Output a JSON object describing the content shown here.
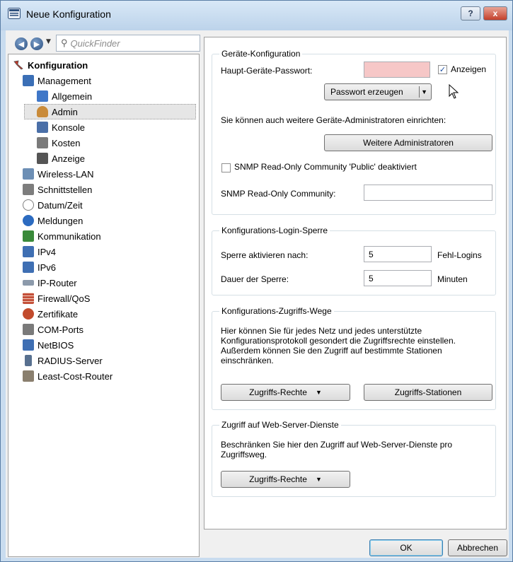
{
  "window": {
    "title": "Neue Konfiguration",
    "help_label": "?",
    "close_label": "x"
  },
  "nav": {
    "quickfinder_placeholder": "QuickFinder"
  },
  "tree": {
    "root": "Konfiguration",
    "items": [
      {
        "label": "Management",
        "icon": "management-icon",
        "color": "#3b6fb6"
      },
      {
        "label": "Allgemein",
        "icon": "general-icon",
        "color": "#3f77c8"
      },
      {
        "label": "Admin",
        "icon": "admin-user-icon",
        "color": "#c98b3a"
      },
      {
        "label": "Konsole",
        "icon": "console-icon",
        "color": "#4a6fa8"
      },
      {
        "label": "Kosten",
        "icon": "costs-icon",
        "color": "#7a7a7a"
      },
      {
        "label": "Anzeige",
        "icon": "display-icon",
        "color": "#555555"
      },
      {
        "label": "Wireless-LAN",
        "icon": "wireless-lan-icon",
        "color": "#6d8fb5"
      },
      {
        "label": "Schnittstellen",
        "icon": "interfaces-icon",
        "color": "#7d7d7d"
      },
      {
        "label": "Datum/Zeit",
        "icon": "clock-icon",
        "color": "#7f7f7f"
      },
      {
        "label": "Meldungen",
        "icon": "info-icon",
        "color": "#2c6bc0"
      },
      {
        "label": "Kommunikation",
        "icon": "communication-icon",
        "color": "#3a8a3a"
      },
      {
        "label": "IPv4",
        "icon": "network-icon",
        "color": "#3f6fb3"
      },
      {
        "label": "IPv6",
        "icon": "network-icon",
        "color": "#3f6fb3"
      },
      {
        "label": "IP-Router",
        "icon": "router-icon",
        "color": "#8c9aab"
      },
      {
        "label": "Firewall/QoS",
        "icon": "firewall-icon",
        "color": "#c4503a"
      },
      {
        "label": "Zertifikate",
        "icon": "certificate-icon",
        "color": "#c24b2c"
      },
      {
        "label": "COM-Ports",
        "icon": "com-port-icon",
        "color": "#7a7a7a"
      },
      {
        "label": "NetBIOS",
        "icon": "network-icon",
        "color": "#3f6fb3"
      },
      {
        "label": "RADIUS-Server",
        "icon": "server-icon",
        "color": "#58708f"
      },
      {
        "label": "Least-Cost-Router",
        "icon": "least-cost-router-icon",
        "color": "#8a7f6e"
      }
    ]
  },
  "geraete": {
    "legend": "Geräte-Konfiguration",
    "password_label": "Haupt-Geräte-Passwort:",
    "show_label": "Anzeigen",
    "generate_button": "Passwort erzeugen",
    "info_text": "Sie können auch weitere Geräte-Administratoren einrichten:",
    "more_admins_button": "Weitere Administratoren",
    "snmp_checkbox_label": "SNMP Read-Only Community 'Public' deaktiviert",
    "snmp_community_label": "SNMP Read-Only Community:",
    "snmp_community_value": ""
  },
  "login_sperre": {
    "legend": "Konfigurations-Login-Sperre",
    "activate_label": "Sperre aktivieren nach:",
    "activate_value": "5",
    "activate_unit": "Fehl-Logins",
    "duration_label": "Dauer der Sperre:",
    "duration_value": "5",
    "duration_unit": "Minuten"
  },
  "zugriffs_wege": {
    "legend": "Konfigurations-Zugriffs-Wege",
    "text_line1": "Hier können Sie für jedes Netz und jedes unterstützte",
    "text_line2": "Konfigurationsprotokoll gesondert die Zugriffsrechte einstellen.",
    "text_line3": "Außerdem können Sie den Zugriff auf bestimmte Stationen",
    "text_line4": "einschränken.",
    "rights_button": "Zugriffs-Rechte",
    "stations_button": "Zugriffs-Stationen"
  },
  "web_server": {
    "legend": "Zugriff auf Web-Server-Dienste",
    "text_line1": "Beschränken Sie hier den Zugriff auf Web-Server-Dienste pro",
    "text_line2": "Zugriffsweg.",
    "rights_button": "Zugriffs-Rechte"
  },
  "footer": {
    "ok_button": "OK",
    "cancel_button": "Abbrechen"
  },
  "colors": {
    "password_field_bg": "#f6c7c7",
    "title_bar": "#c9dcef"
  }
}
